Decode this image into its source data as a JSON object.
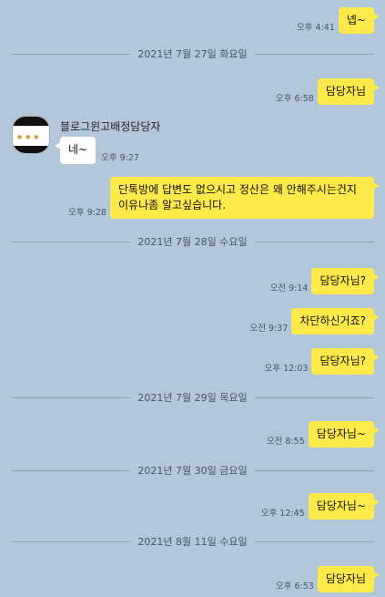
{
  "chat": {
    "sender_name": "블로그윈고배정담당자",
    "dates": [
      "2021년 7월 27일 화요일",
      "2021년 7월 28일 수요일",
      "2021년 7월 29일 목요일",
      "2021년 7월 30일 금요일",
      "2021년 8월 11일 수요일"
    ],
    "messages": [
      {
        "from": "me",
        "text": "넵~",
        "time": "오후 4:41"
      },
      {
        "from": "me",
        "text": "담당자님",
        "time": "오후 6:58"
      },
      {
        "from": "other",
        "text": "네~",
        "time": "오후 9:27"
      },
      {
        "from": "me",
        "text": "단톡방에 답변도 없으시고 정산은 왜 안해주시는건지 이유나좀 알고싶습니다.",
        "time": "오후 9:28"
      },
      {
        "from": "me",
        "text": "담당자님?",
        "time": "오전 9:14"
      },
      {
        "from": "me",
        "text": "차단하신거죠?",
        "time": "오전 9:37"
      },
      {
        "from": "me",
        "text": "담당자님?",
        "time": "오후 12:03"
      },
      {
        "from": "me",
        "text": "담당자님~",
        "time": "오전 8:55"
      },
      {
        "from": "me",
        "text": "담당자님~",
        "time": "오후 12:45"
      },
      {
        "from": "me",
        "text": "담당자님",
        "time": "오후 6:53"
      }
    ]
  },
  "colors": {
    "background": "#b2c7d9",
    "my_bubble": "#fee94b",
    "other_bubble": "#ffffff"
  }
}
